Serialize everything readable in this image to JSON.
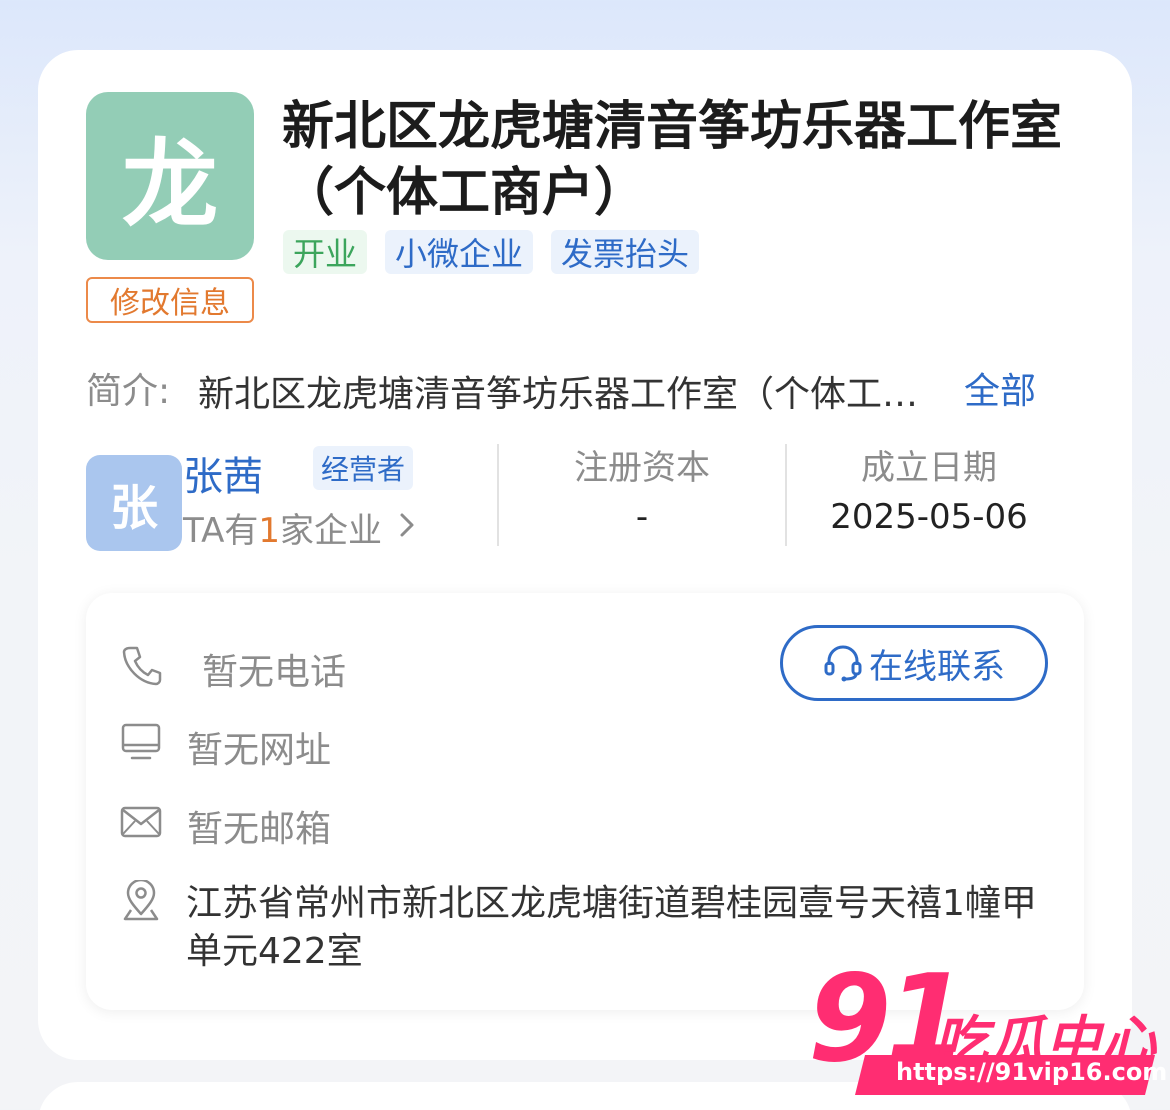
{
  "company": {
    "logo_char": "龙",
    "name": "新北区龙虎塘清音筝坊乐器工作室（个体工商户）",
    "edit_label": "修改信息",
    "tags": [
      "开业",
      "小微企业",
      "发票抬头"
    ]
  },
  "intro": {
    "label": "简介:",
    "text": "新北区龙虎塘清音筝坊乐器工作室（个体工商户）",
    "more_label": "全部"
  },
  "operator": {
    "avatar_char": "张",
    "name": "张茜",
    "role": "经营者",
    "count_prefix": "TA有",
    "count": "1",
    "count_suffix": "家企业"
  },
  "stats": {
    "capital_label": "注册资本",
    "capital_value": "-",
    "date_label": "成立日期",
    "date_value": "2025-05-06"
  },
  "contact": {
    "phone": "暂无电话",
    "website": "暂无网址",
    "email": "暂无邮箱",
    "address": "江苏省常州市新北区龙虎塘街道碧桂园壹号天禧1幢甲单元422室",
    "online_label": "在线联系"
  },
  "watermark": {
    "number": "91",
    "name": "吃瓜中心",
    "url": "https://91vip16.com"
  },
  "colors": {
    "brand_blue": "#2e6bc7",
    "orange": "#e2792f",
    "green": "#3ca55c",
    "logo_bg": "#93cdb6",
    "watermark": "#ff2d72"
  }
}
